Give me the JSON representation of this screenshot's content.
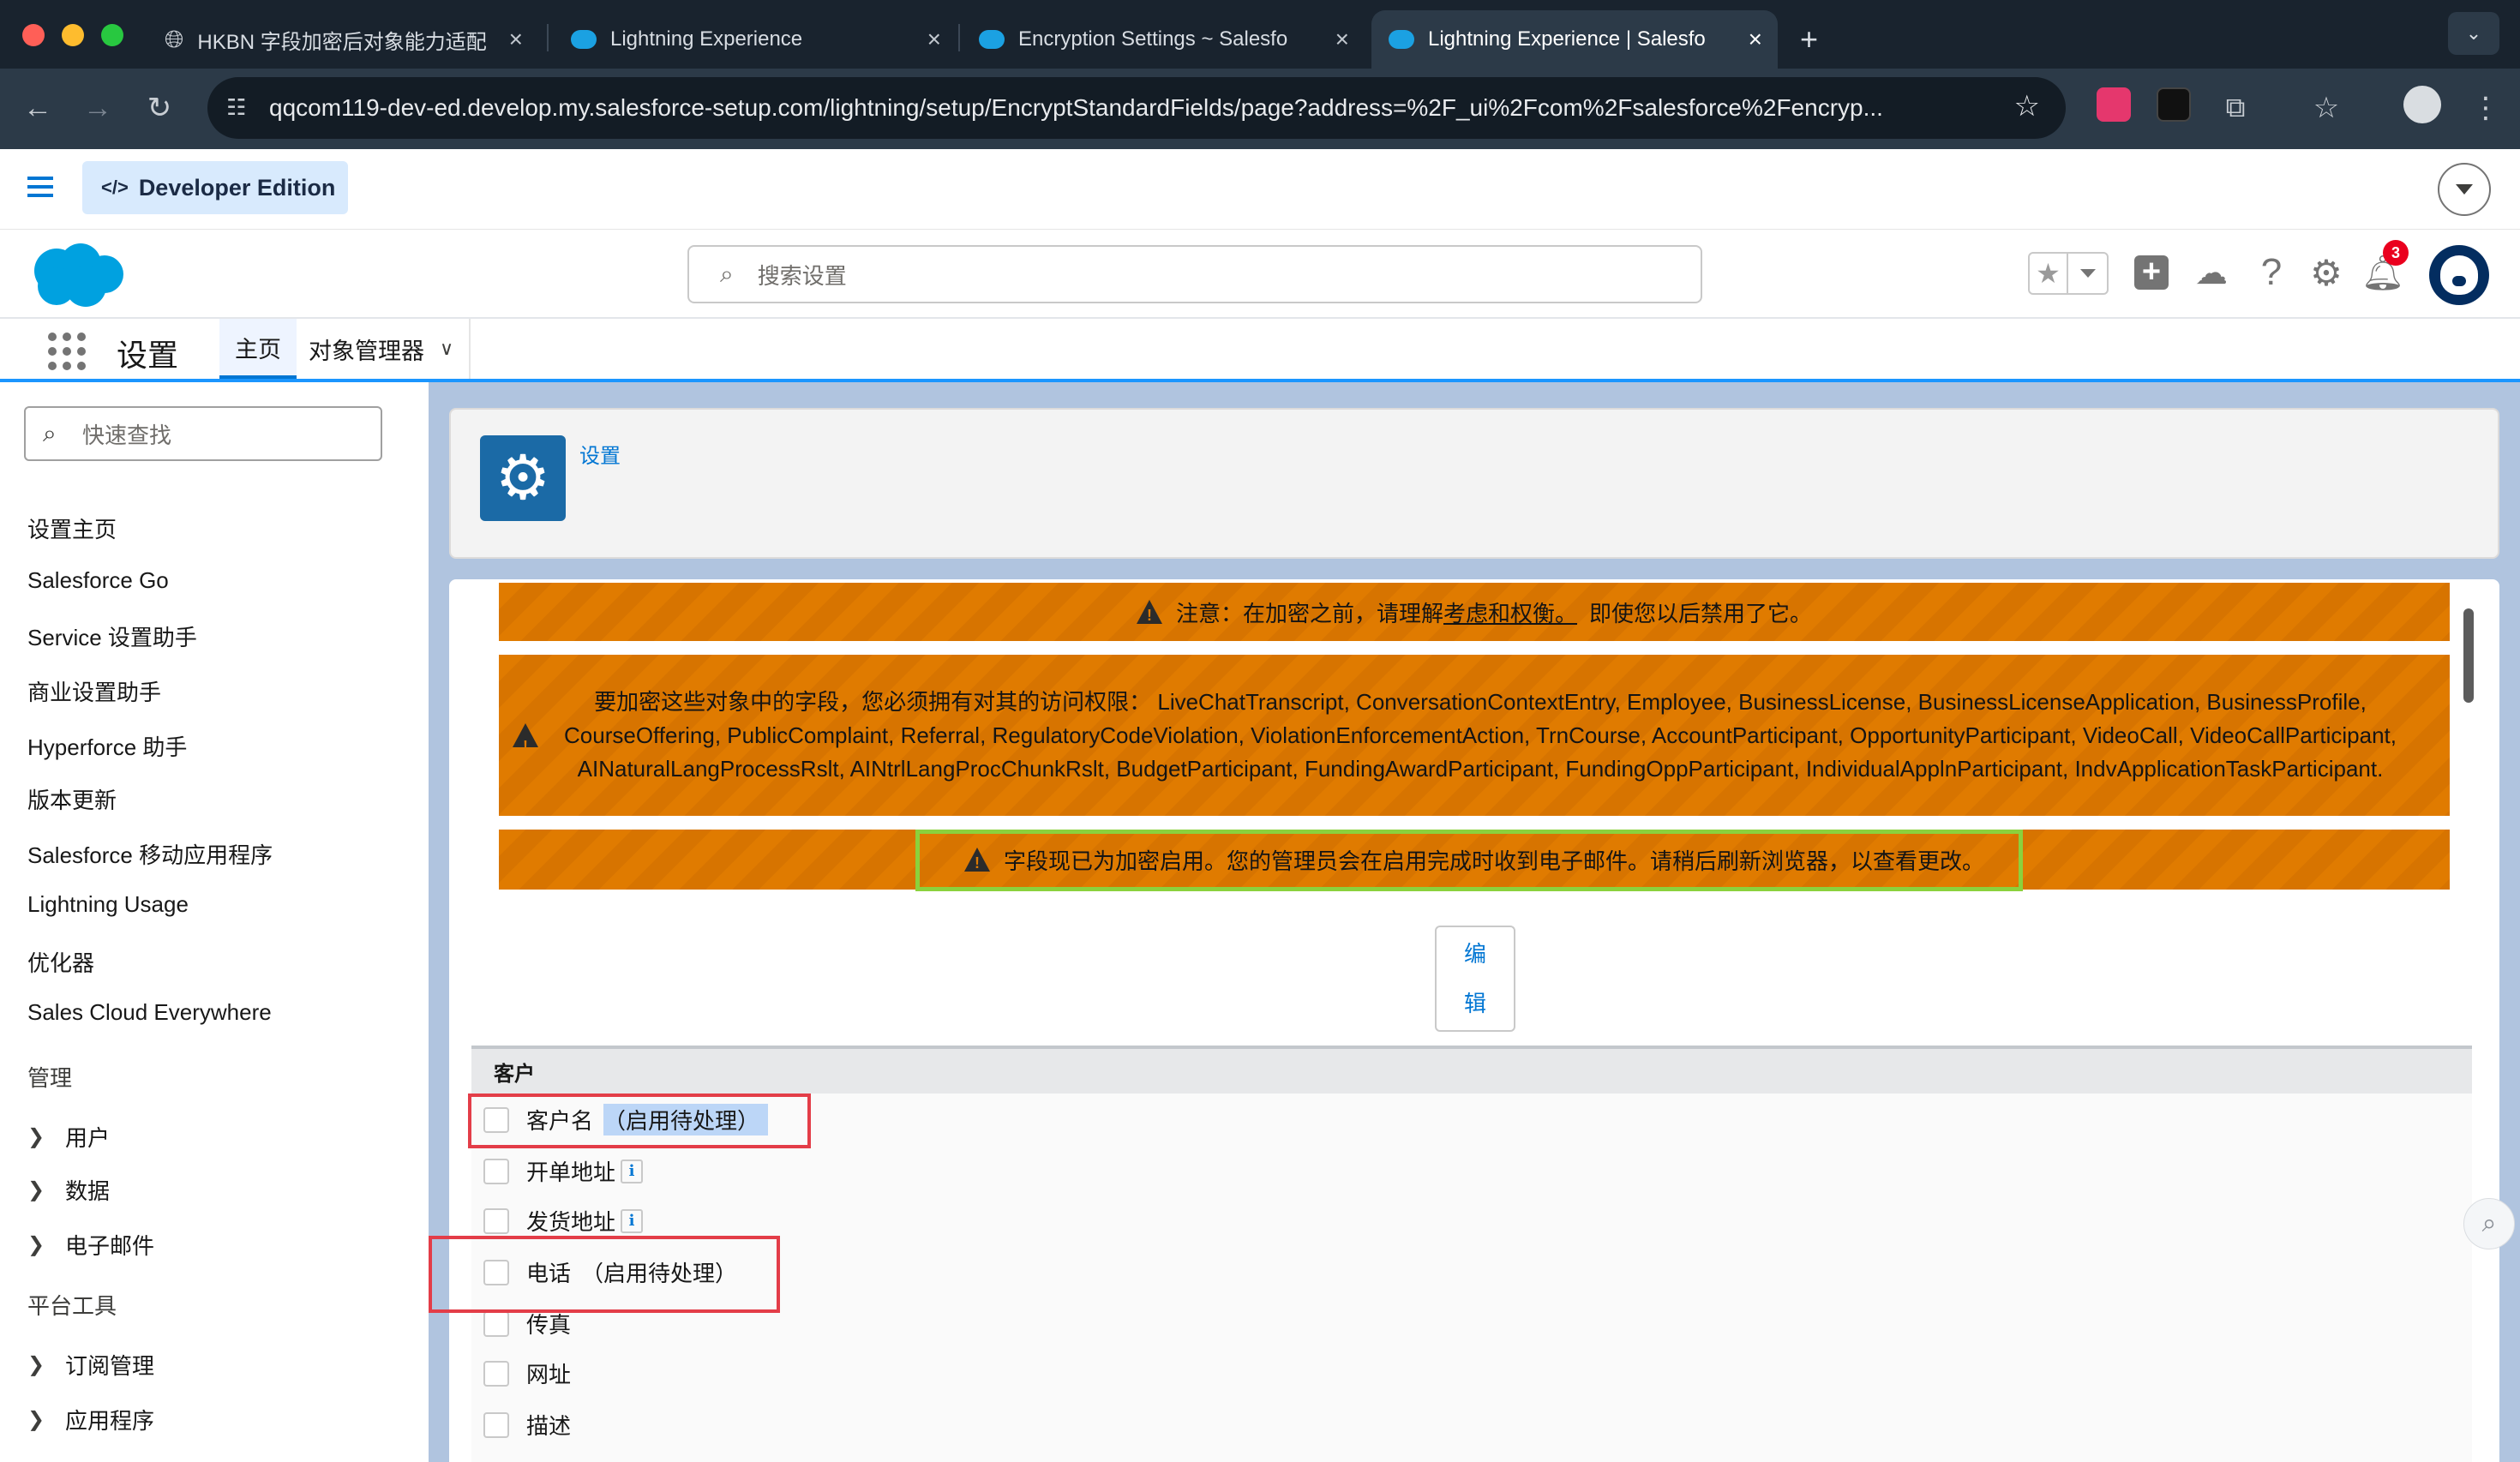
{
  "browser": {
    "tabs": [
      {
        "title": "HKBN 字段加密后对象能力适配",
        "icon": "globe-icon",
        "active": false
      },
      {
        "title": "Lightning Experience",
        "icon": "salesforce-cloud-icon",
        "active": false
      },
      {
        "title": "Encryption Settings ~ Salesfo",
        "icon": "salesforce-cloud-icon",
        "active": false
      },
      {
        "title": "Lightning Experience | Salesfo",
        "icon": "salesforce-cloud-icon",
        "active": true
      }
    ],
    "url": "qqcom119-dev-ed.develop.my.salesforce-setup.com/lightning/setup/EncryptStandardFields/page?address=%2F_ui%2Fcom%2Fsalesforce%2Fencryp...",
    "colors": {
      "tabbar": "#19232e",
      "toolbar": "#2c3a48"
    }
  },
  "topbar": {
    "edition_label": "Developer Edition"
  },
  "header": {
    "search_placeholder": "搜索设置",
    "notification_count": "3"
  },
  "appnav": {
    "app_title": "设置",
    "tabs": [
      {
        "label": "主页",
        "active": true
      },
      {
        "label": "对象管理器",
        "active": false
      }
    ]
  },
  "sidebar": {
    "quickfind_placeholder": "快速查找",
    "items": [
      "设置主页",
      "Salesforce Go",
      "Service 设置助手",
      "商业设置助手",
      "Hyperforce 助手",
      "版本更新",
      "Salesforce 移动应用程序",
      "Lightning Usage",
      "优化器",
      "Sales Cloud Everywhere"
    ],
    "group_admin": "管理",
    "admin_items": [
      "用户",
      "数据",
      "电子邮件"
    ],
    "group_platform": "平台工具",
    "platform_items": [
      "订阅管理",
      "应用程序"
    ]
  },
  "page_header": {
    "breadcrumb": "设置"
  },
  "warnings": {
    "w1_prefix": "注意：在加密之前，请理解",
    "w1_link": "考虑和权衡。",
    "w1_suffix": " 即使您以后禁用了它。",
    "w2_text": "要加密这些对象中的字段，您必须拥有对其的访问权限： LiveChatTranscript, ConversationContextEntry, Employee, BusinessLicense, BusinessLicenseApplication, BusinessProfile, CourseOffering, PublicComplaint, Referral, RegulatoryCodeViolation, ViolationEnforcementAction, TrnCourse, AccountParticipant, OpportunityParticipant, VideoCall, VideoCallParticipant, AINaturalLangProcessRslt, AINtrlLangProcChunkRslt, BudgetParticipant, FundingAwardParticipant, FundingOppParticipant, IndividualApplnParticipant, IndvApplicationTaskParticipant.",
    "w3_text": "字段现已为加密启用。您的管理员会在启用完成时收到电子邮件。请稍后刷新浏览器，以查看更改。",
    "color": "#e07b00"
  },
  "edit_button": {
    "line1": "编",
    "line2": "辑"
  },
  "section": {
    "title": "客户",
    "fields": [
      {
        "label": "客户名",
        "status": "（启用待处理）",
        "info": false
      },
      {
        "label": "开单地址",
        "status": "",
        "info": true
      },
      {
        "label": "发货地址",
        "status": "",
        "info": true
      },
      {
        "label": "电话",
        "status": "（启用待处理）",
        "info": false
      },
      {
        "label": "传真",
        "status": "",
        "info": false
      },
      {
        "label": "网址",
        "status": "",
        "info": false
      },
      {
        "label": "描述",
        "status": "",
        "info": false
      }
    ],
    "info_glyph": "i"
  },
  "annotations": {
    "red": "#e33d48",
    "green": "#8bd13d"
  }
}
